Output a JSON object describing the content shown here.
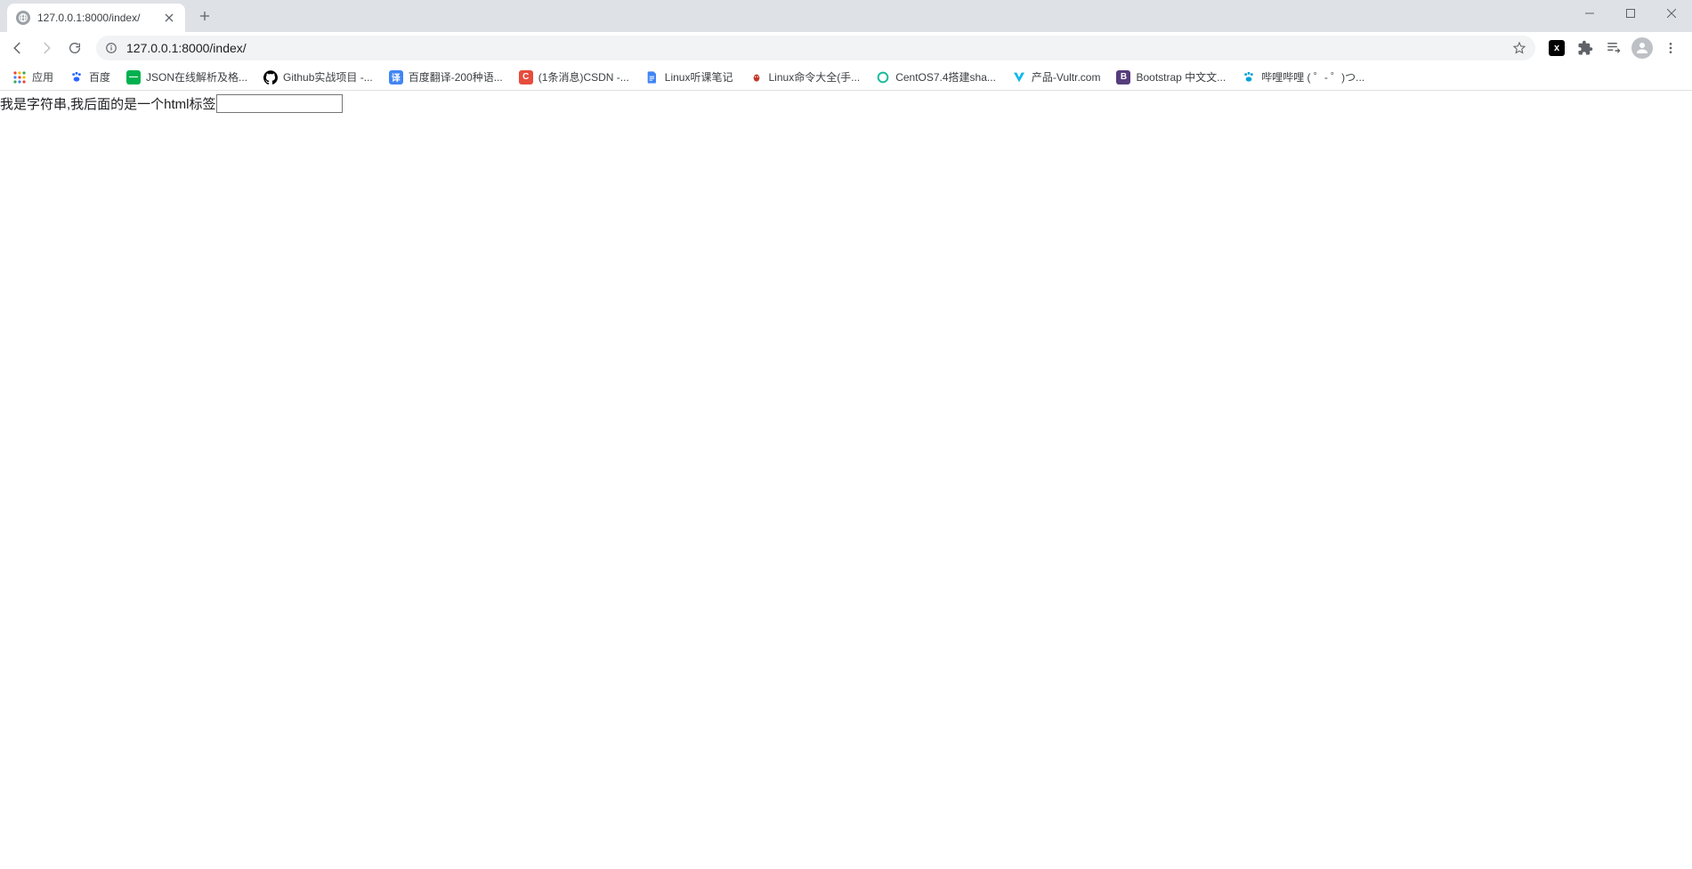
{
  "browser": {
    "tab_title": "127.0.0.1:8000/index/",
    "address": "127.0.0.1:8000/index/"
  },
  "bookmarks": [
    {
      "label": "应用",
      "icon": "apps",
      "color": ""
    },
    {
      "label": "百度",
      "icon": "paw",
      "color": "#2a66ff"
    },
    {
      "label": "JSON在线解析及格...",
      "icon": "jay",
      "color": "#00b14f"
    },
    {
      "label": "Github实战项目 -...",
      "icon": "gh",
      "color": "#000000"
    },
    {
      "label": "百度翻译-200种语...",
      "icon": "yi",
      "color": "#4285f4"
    },
    {
      "label": "(1条消息)CSDN -...",
      "icon": "c",
      "color": "#e74c3c"
    },
    {
      "label": "Linux听课笔记",
      "icon": "doc",
      "color": "#4285f4"
    },
    {
      "label": "Linux命令大全(手...",
      "icon": "bug",
      "color": "#c0392b"
    },
    {
      "label": "CentOS7.4搭建sha...",
      "icon": "g",
      "color": "#1abc9c"
    },
    {
      "label": "产品-Vultr.com",
      "icon": "v",
      "color": "#0db7ed"
    },
    {
      "label": "Bootstrap 中文文...",
      "icon": "b",
      "color": "#563d7c"
    },
    {
      "label": "哔哩哔哩 ( ゜- ゜)つ...",
      "icon": "paw",
      "color": "#00a1d6"
    }
  ],
  "page": {
    "text": "我是字符串,我后面的是一个html标签",
    "input_value": ""
  }
}
